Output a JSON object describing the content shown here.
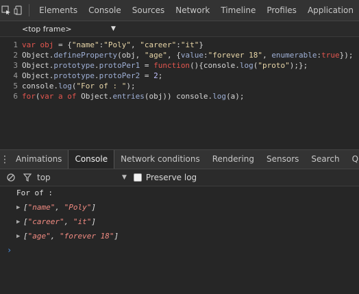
{
  "toolbar": {
    "tabs": [
      "Elements",
      "Console",
      "Sources",
      "Network",
      "Timeline",
      "Profiles",
      "Application"
    ]
  },
  "frame": {
    "label": "<top frame>"
  },
  "editor": {
    "lines": [
      {
        "n": "1",
        "segs": [
          [
            "kw",
            "var"
          ],
          [
            "code",
            " "
          ],
          [
            "kw",
            "obj"
          ],
          [
            "code",
            " = {"
          ],
          [
            "str",
            "\"name\""
          ],
          [
            "code",
            ":"
          ],
          [
            "str",
            "\"Poly\""
          ],
          [
            "code",
            ", "
          ],
          [
            "str",
            "\"career\""
          ],
          [
            "code",
            ":"
          ],
          [
            "str",
            "\"it\""
          ],
          [
            "code",
            "}"
          ]
        ]
      },
      {
        "n": "2",
        "segs": [
          [
            "code",
            "Object."
          ],
          [
            "prop",
            "defineProperty"
          ],
          [
            "code",
            "(obj, "
          ],
          [
            "str",
            "\"age\""
          ],
          [
            "code",
            ", {"
          ],
          [
            "prop",
            "value"
          ],
          [
            "code",
            ":"
          ],
          [
            "str",
            "\"forever 18\""
          ],
          [
            "code",
            ", "
          ],
          [
            "prop",
            "enumerable"
          ],
          [
            "code",
            ":"
          ],
          [
            "kw",
            "true"
          ],
          [
            "code",
            "});"
          ]
        ]
      },
      {
        "n": "3",
        "segs": [
          [
            "code",
            "Object."
          ],
          [
            "prop",
            "prototype"
          ],
          [
            "code",
            "."
          ],
          [
            "prop",
            "protoPer1"
          ],
          [
            "code",
            " = "
          ],
          [
            "kw",
            "function"
          ],
          [
            "code",
            "(){console."
          ],
          [
            "prop",
            "log"
          ],
          [
            "code",
            "("
          ],
          [
            "str",
            "\"proto\""
          ],
          [
            "code",
            ");};"
          ]
        ]
      },
      {
        "n": "4",
        "segs": [
          [
            "code",
            "Object."
          ],
          [
            "prop",
            "prototype"
          ],
          [
            "code",
            "."
          ],
          [
            "prop",
            "protoPer2"
          ],
          [
            "code",
            " = "
          ],
          [
            "num",
            "2"
          ],
          [
            "code",
            ";"
          ]
        ]
      },
      {
        "n": "5",
        "segs": [
          [
            "code",
            "console."
          ],
          [
            "prop",
            "log"
          ],
          [
            "code",
            "("
          ],
          [
            "str",
            "\"For of : \""
          ],
          [
            "code",
            ");"
          ]
        ]
      },
      {
        "n": "6",
        "segs": [
          [
            "kw",
            "for"
          ],
          [
            "code",
            "("
          ],
          [
            "kw",
            "var"
          ],
          [
            "code",
            " "
          ],
          [
            "kw",
            "a"
          ],
          [
            "code",
            " "
          ],
          [
            "kw",
            "of"
          ],
          [
            "code",
            " Object."
          ],
          [
            "prop",
            "entries"
          ],
          [
            "code",
            "(obj)) console."
          ],
          [
            "prop",
            "log"
          ],
          [
            "code",
            "(a);"
          ]
        ]
      }
    ]
  },
  "drawer": {
    "tabs": [
      "Animations",
      "Console",
      "Network conditions",
      "Rendering",
      "Sensors",
      "Search",
      "Qu"
    ],
    "active": "Console"
  },
  "console_toolbar": {
    "context": "top",
    "preserve_log": "Preserve log"
  },
  "console": {
    "first_line": "For of :",
    "arrays": [
      [
        "\"name\"",
        "\"Poly\""
      ],
      [
        "\"career\"",
        "\"it\""
      ],
      [
        "\"age\"",
        "\"forever 18\""
      ]
    ],
    "prompt": "›"
  }
}
